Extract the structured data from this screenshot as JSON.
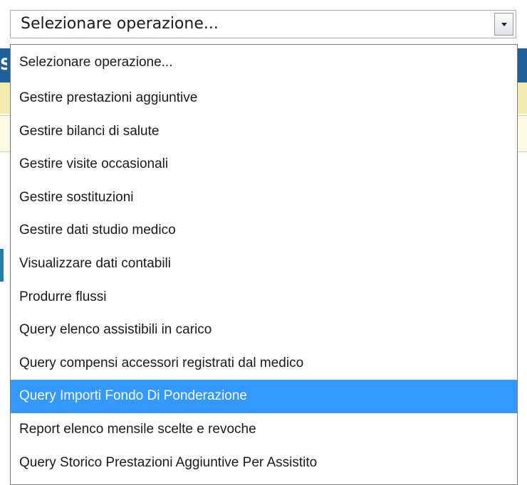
{
  "select": {
    "value": "Selezionare operazione...",
    "arrow_icon": "chevron-down-icon"
  },
  "dropdown": {
    "options": [
      "Selezionare operazione...",
      "Gestire prestazioni aggiuntive",
      "Gestire bilanci di salute",
      "Gestire visite occasionali",
      "Gestire sostituzioni",
      "Gestire dati studio medico",
      "Visualizzare dati contabili",
      "Produrre flussi",
      "Query elenco assistibili in carico",
      "Query compensi accessori registrati dal medico",
      "Query Importi Fondo Di Ponderazione",
      "Report elenco mensile scelte e revoche",
      "Query Storico Prestazioni Aggiuntive Per Assistito"
    ],
    "highlighted_index": 10
  },
  "colors": {
    "highlight": "#3399ff",
    "header_blue": "#1f5f9c",
    "toolbar_yellow": "#f2ecb0"
  }
}
